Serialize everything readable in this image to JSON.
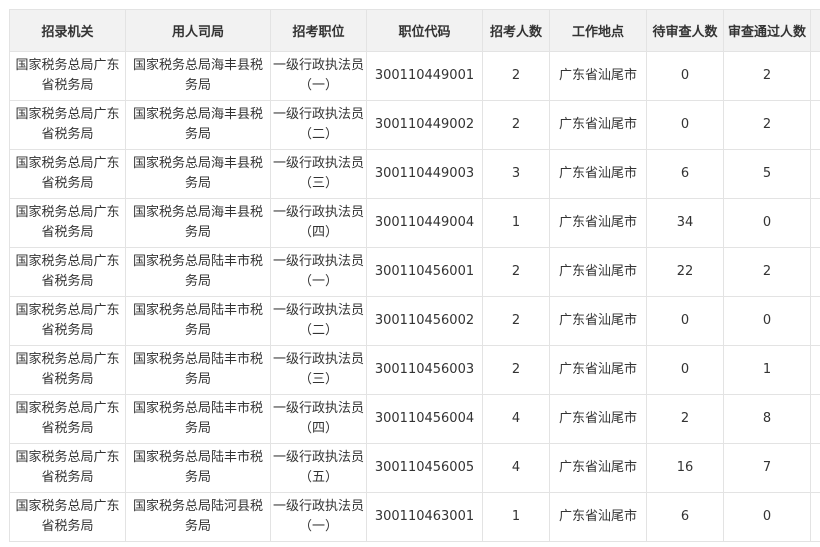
{
  "table": {
    "headers": [
      "招录机关",
      "用人司局",
      "招考职位",
      "职位代码",
      "招考人数",
      "工作地点",
      "待审查人数",
      "审查通过人数"
    ],
    "rows": [
      [
        "国家税务总局广东省税务局",
        "国家税务总局海丰县税务局",
        "一级行政执法员（一）",
        "300110449001",
        "2",
        "广东省汕尾市",
        "0",
        "2"
      ],
      [
        "国家税务总局广东省税务局",
        "国家税务总局海丰县税务局",
        "一级行政执法员（二）",
        "300110449002",
        "2",
        "广东省汕尾市",
        "0",
        "2"
      ],
      [
        "国家税务总局广东省税务局",
        "国家税务总局海丰县税务局",
        "一级行政执法员（三）",
        "300110449003",
        "3",
        "广东省汕尾市",
        "6",
        "5"
      ],
      [
        "国家税务总局广东省税务局",
        "国家税务总局海丰县税务局",
        "一级行政执法员（四）",
        "300110449004",
        "1",
        "广东省汕尾市",
        "34",
        "0"
      ],
      [
        "国家税务总局广东省税务局",
        "国家税务总局陆丰市税务局",
        "一级行政执法员（一）",
        "300110456001",
        "2",
        "广东省汕尾市",
        "22",
        "2"
      ],
      [
        "国家税务总局广东省税务局",
        "国家税务总局陆丰市税务局",
        "一级行政执法员（二）",
        "300110456002",
        "2",
        "广东省汕尾市",
        "0",
        "0"
      ],
      [
        "国家税务总局广东省税务局",
        "国家税务总局陆丰市税务局",
        "一级行政执法员（三）",
        "300110456003",
        "2",
        "广东省汕尾市",
        "0",
        "1"
      ],
      [
        "国家税务总局广东省税务局",
        "国家税务总局陆丰市税务局",
        "一级行政执法员（四）",
        "300110456004",
        "4",
        "广东省汕尾市",
        "2",
        "8"
      ],
      [
        "国家税务总局广东省税务局",
        "国家税务总局陆丰市税务局",
        "一级行政执法员（五）",
        "300110456005",
        "4",
        "广东省汕尾市",
        "16",
        "7"
      ],
      [
        "国家税务总局广东省税务局",
        "国家税务总局陆河县税务局",
        "一级行政执法员（一）",
        "300110463001",
        "1",
        "广东省汕尾市",
        "6",
        "0"
      ]
    ]
  }
}
